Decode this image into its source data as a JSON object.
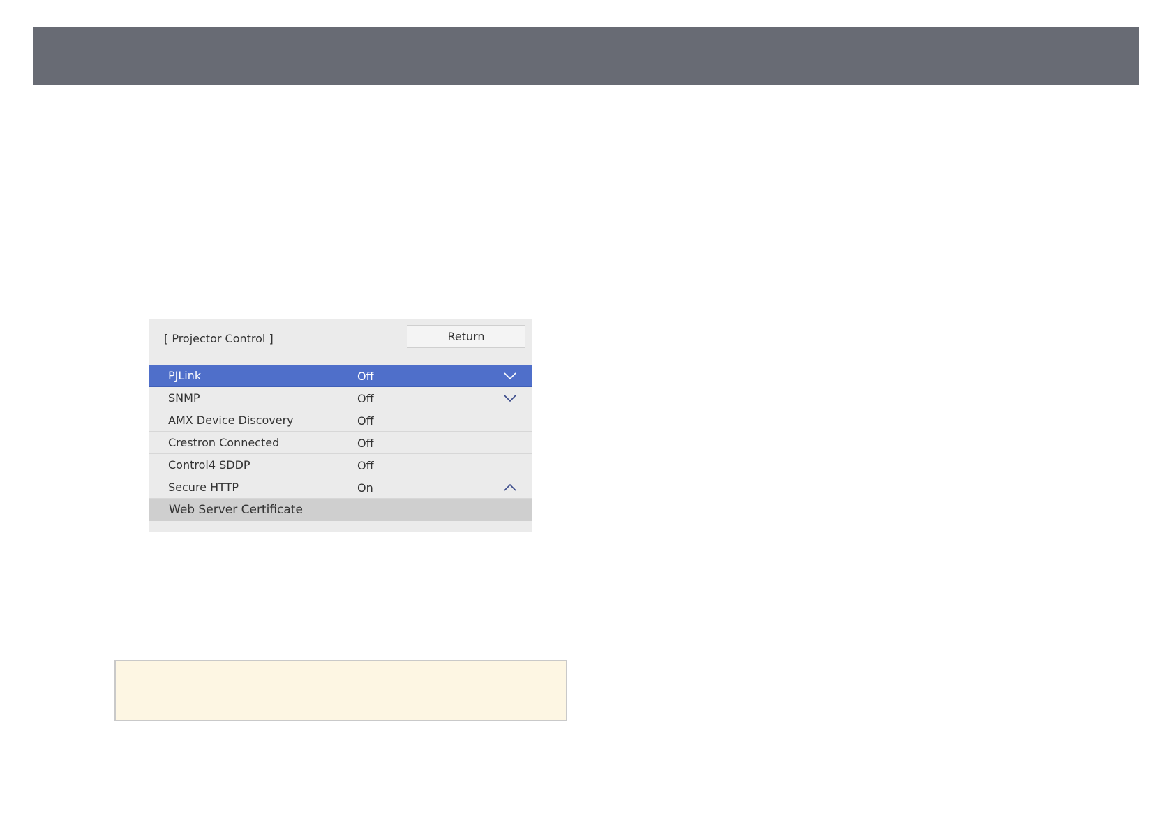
{
  "panel": {
    "title": "[ Projector Control ]",
    "return_label": "Return",
    "rows": [
      {
        "label": "PJLink",
        "value": "Off",
        "icon": "chevron-down-icon"
      },
      {
        "label": "SNMP",
        "value": "Off",
        "icon": "chevron-down-icon"
      },
      {
        "label": "AMX Device Discovery",
        "value": "Off",
        "icon": ""
      },
      {
        "label": "Crestron Connected",
        "value": "Off",
        "icon": ""
      },
      {
        "label": "Control4 SDDP",
        "value": "Off",
        "icon": ""
      },
      {
        "label": "Secure HTTP",
        "value": "On",
        "icon": "chevron-up-icon"
      }
    ],
    "sub_item": {
      "label": "Web Server Certificate"
    }
  },
  "colors": {
    "banner": "#686b74",
    "selected_row": "#4f6fca",
    "panel_bg": "#ebebeb",
    "sub_item_bg": "#cfcfcf",
    "note_bg": "#fdf6e3"
  }
}
